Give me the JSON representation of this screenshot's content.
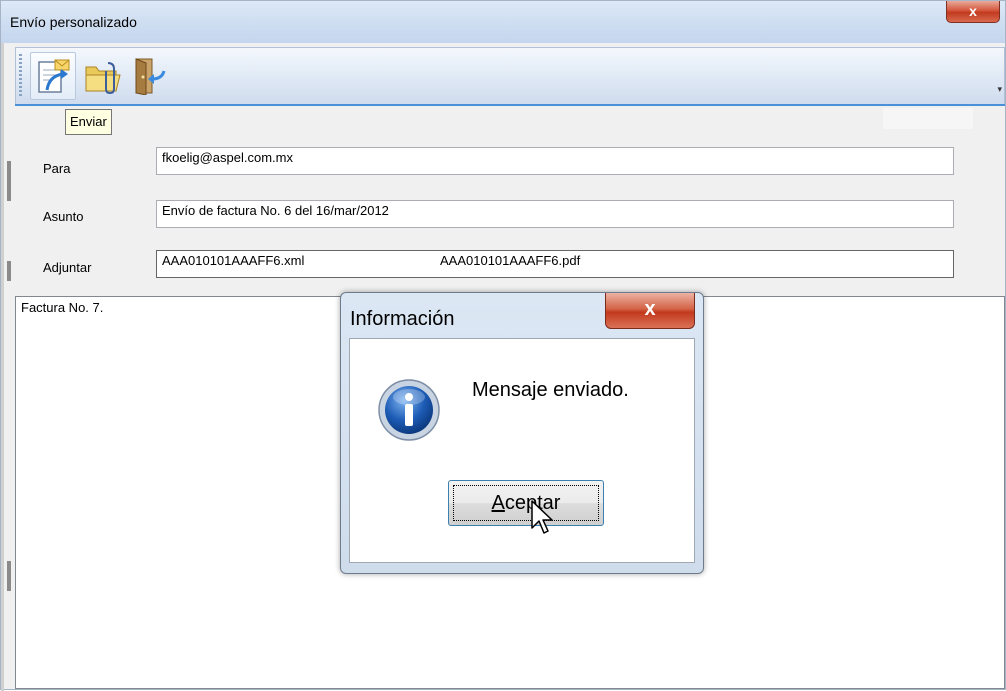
{
  "window": {
    "title": "Envío  personalizado",
    "close_symbol": "x"
  },
  "toolbar": {
    "buttons": [
      {
        "name": "enviar",
        "icon": "send-mail-icon"
      },
      {
        "name": "adjuntar",
        "icon": "attach-folder-icon"
      },
      {
        "name": "salir",
        "icon": "exit-door-icon"
      }
    ],
    "tooltip": "Enviar",
    "overflow_symbol": "▾"
  },
  "form": {
    "para_label": "Para",
    "para_value": "fkoelig@aspel.com.mx",
    "asunto_label": "Asunto",
    "asunto_value": "Envío de factura No. 6 del 16/mar/2012",
    "adjuntar_label": "Adjuntar",
    "attachments": [
      "AAA010101AAAFF6.xml",
      "AAA010101AAAFF6.pdf"
    ]
  },
  "message_body": "Factura No. 7.",
  "dialog": {
    "title": "Información",
    "close_symbol": "x",
    "icon": "info-icon",
    "message": "Mensaje enviado.",
    "ok_label": "Aceptar"
  },
  "colors": {
    "accent": "#4a90d9",
    "close_red": "#c23a1f",
    "tooltip_bg": "#ffffe1",
    "info_blue": "#1d5cb6"
  }
}
